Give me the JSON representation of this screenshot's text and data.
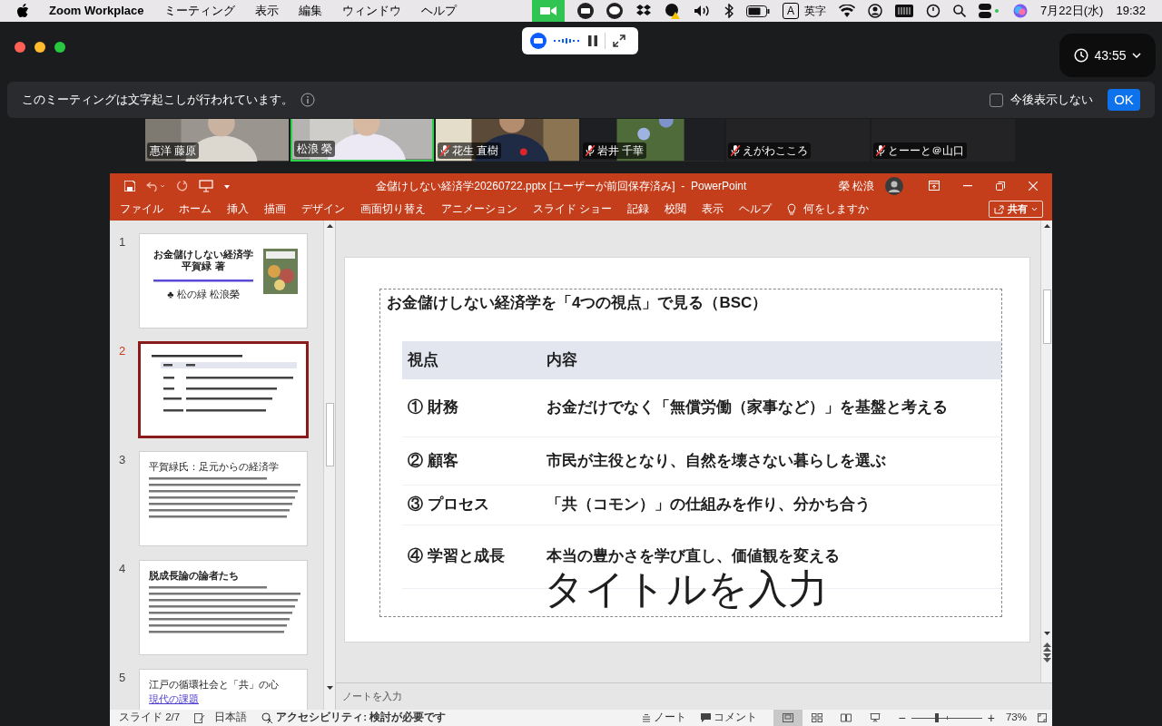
{
  "menu_bar": {
    "app": "Zoom Workplace",
    "menus": [
      "ミーティング",
      "表示",
      "編集",
      "ウィンドウ",
      "ヘルプ"
    ],
    "input_key": "A",
    "input_label": "英字",
    "date": "7月22日(水)",
    "time": "19:32"
  },
  "zoom": {
    "timer": "43:55",
    "banner": {
      "text": "このミーティングは文字起こしが行われています。",
      "checkbox_label": "今後表示しない",
      "checked": false,
      "ok": "OK"
    },
    "participants": [
      {
        "kind": "video",
        "name": "惠洋 藤原",
        "muted": false,
        "selected": false
      },
      {
        "kind": "video",
        "name": "松浪 榮",
        "muted": false,
        "selected": true
      },
      {
        "kind": "video",
        "name": "花生 直樹",
        "muted": true,
        "selected": false
      },
      {
        "kind": "video",
        "name": "岩井 千華",
        "muted": true,
        "selected": false
      },
      {
        "kind": "name",
        "name": "えがわこころ",
        "muted": true,
        "selected": false
      },
      {
        "kind": "name",
        "name": "とーーと＠山口",
        "muted": true,
        "selected": false
      }
    ]
  },
  "powerpoint": {
    "title": "金儲けしない経済学20260722.pptx [ユーザーが前回保存済み]  -  PowerPoint",
    "user": "榮 松浪",
    "tabs": [
      "ファイル",
      "ホーム",
      "挿入",
      "描画",
      "デザイン",
      "画面切り替え",
      "アニメーション",
      "スライド ショー",
      "記録",
      "校閲",
      "表示",
      "ヘルプ"
    ],
    "tell_me": "何をしますか",
    "share": "共有",
    "thumbnails": [
      {
        "number": "1",
        "selected": false,
        "title": "お金儲けしない経済学",
        "lines": [
          "平賀緑 著",
          "♣ 松の緑 松浪榮"
        ]
      },
      {
        "number": "2",
        "selected": true
      },
      {
        "number": "3",
        "selected": false,
        "title": "平賀緑氏：足元からの経済学"
      },
      {
        "number": "4",
        "selected": false,
        "title": "脱成長論の論者たち"
      },
      {
        "number": "5",
        "selected": false,
        "title": "江戸の循環社会と「共」の心",
        "lines": [
          "現代の課題"
        ]
      }
    ],
    "slide": {
      "title": "お金儲けしない経済学を「4つの視点」で見る（BSC）",
      "columns": [
        "視点",
        "内容"
      ],
      "rows": [
        [
          "① 財務",
          "お金だけでなく「無償労働（家事など）」を基盤と考える"
        ],
        [
          "② 顧客",
          "市民が主役となり、自然を壊さない暮らしを選ぶ"
        ],
        [
          "③ プロセス",
          "「共（コモン）」の仕組みを作り、分かち合う"
        ],
        [
          "④ 学習と成長",
          "本当の豊かさを学び直し、価値観を変える"
        ]
      ],
      "placeholder": "タイトルを入力"
    },
    "notes_placeholder": "ノートを入力",
    "status_bar": {
      "slide": "スライド 2/7",
      "language": "日本語",
      "accessibility": "アクセシビリティ: 検討が必要です",
      "notes": "ノート",
      "comments": "コメント",
      "zoom_out": "−",
      "zoom_in": "+",
      "zoom": "73%",
      "level": 0.36
    }
  }
}
